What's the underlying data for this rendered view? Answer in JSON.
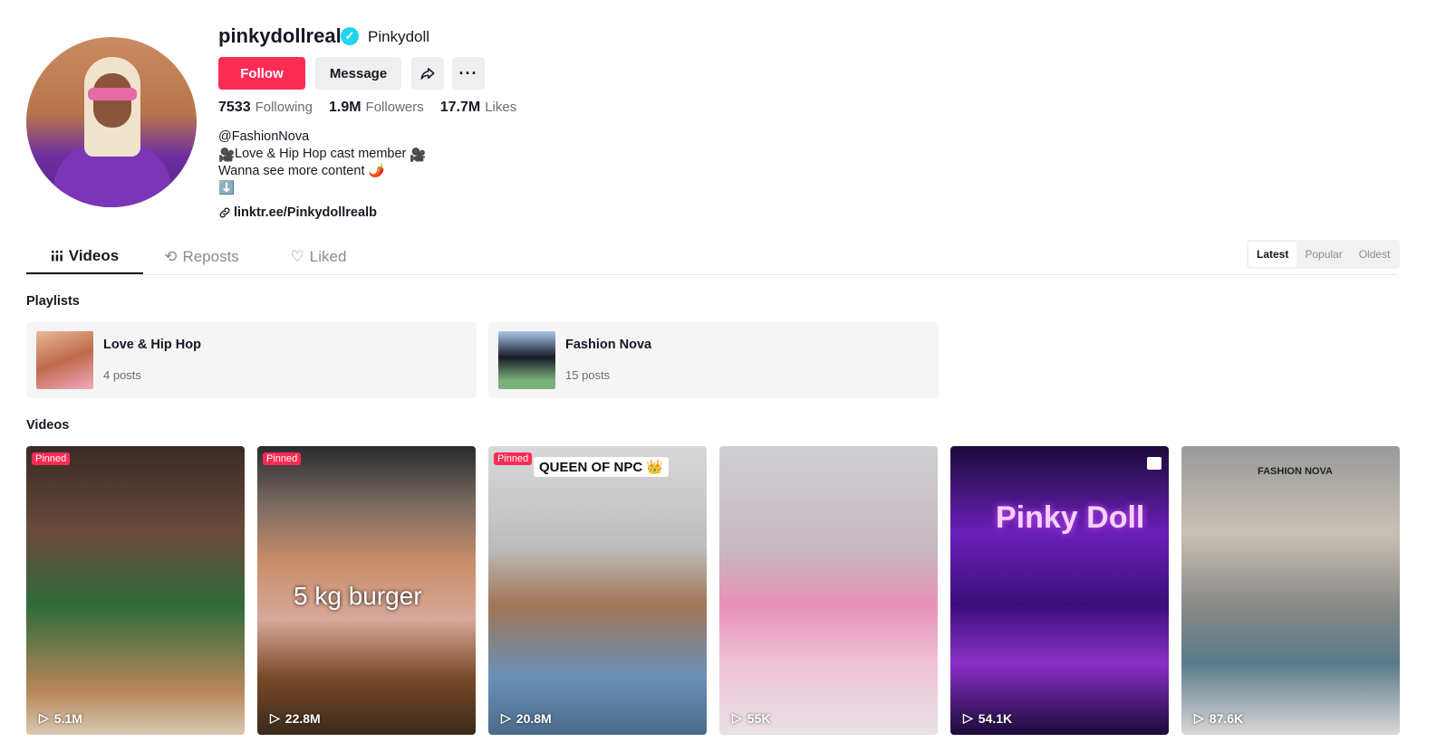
{
  "profile": {
    "username": "pinkydollreal",
    "nickname": "Pinkydoll",
    "verified_icon": "verified-check-icon",
    "buttons": {
      "follow": "Follow",
      "message": "Message",
      "more": "···"
    },
    "stats": [
      {
        "num": "7533",
        "label": "Following"
      },
      {
        "num": "1.9M",
        "label": "Followers"
      },
      {
        "num": "17.7M",
        "label": "Likes"
      }
    ],
    "bio": [
      "@FashionNova",
      "Love & Hip Hop cast member",
      "Wanna see more content",
      "⬇️"
    ],
    "link": "linktr.ee/Pinkydollrealb"
  },
  "tabs": [
    {
      "label": "Videos",
      "icon": "grid-icon"
    },
    {
      "label": "Reposts",
      "icon": "repost-icon"
    },
    {
      "label": "Liked",
      "icon": "heart-icon"
    }
  ],
  "sort": {
    "options": [
      "Latest",
      "Popular",
      "Oldest"
    ],
    "selected": "Latest"
  },
  "playlists_title": "Playlists",
  "playlists": [
    {
      "name": "Love & Hip Hop",
      "count": "4 posts"
    },
    {
      "name": "Fashion Nova",
      "count": "15 posts"
    }
  ],
  "videos_title": "Videos",
  "videos": [
    {
      "pinned": "Pinned",
      "views": "5.1M"
    },
    {
      "pinned": "Pinned",
      "views": "22.8M",
      "overlay": "5 kg burger"
    },
    {
      "pinned": "Pinned",
      "views": "20.8M",
      "overlay": "QUEEN OF NPC 👑"
    },
    {
      "views": "55K"
    },
    {
      "views": "54.1K",
      "overlay": "Pinky Doll"
    },
    {
      "views": "87.6K",
      "overlay": "FASHION NOVA"
    }
  ],
  "colors": {
    "accent": "#fe2c55",
    "verified": "#20d5ec"
  }
}
